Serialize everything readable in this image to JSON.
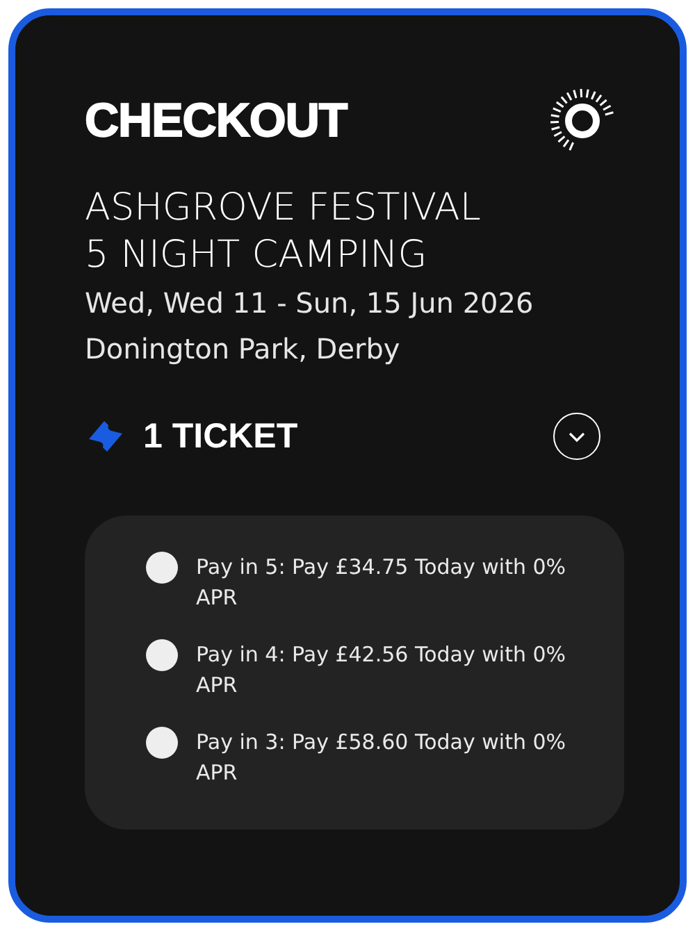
{
  "header": {
    "title": "CHECKOUT"
  },
  "event": {
    "title_lines": [
      "ASHGROVE FESTIVAL",
      "5 NIGHT CAMPING"
    ],
    "dates": "Wed, Wed 11 - Sun, 15 Jun 2026",
    "venue": "Donington Park, Derby"
  },
  "tickets": {
    "label": "1 TICKET",
    "expanded": false
  },
  "payment_options": [
    {
      "label": "Pay in 5: Pay £34.75 Today with 0% APR",
      "selected": false
    },
    {
      "label": "Pay in 4: Pay £42.56 Today with 0% APR",
      "selected": false
    },
    {
      "label": "Pay in 3: Pay £58.60 Today with 0% APR",
      "selected": false
    }
  ]
}
